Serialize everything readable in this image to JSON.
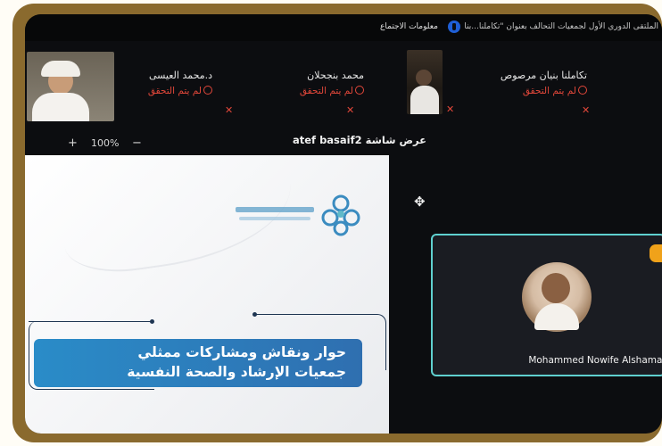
{
  "topbar": {
    "meeting_title": "الملتقى الدوري الأول لجمعيات التحالف بعنوان \"تكاملنا...بنا",
    "meeting_info_label": "معلومات الاجتماع",
    "shield_icon": "shield-icon"
  },
  "participants": [
    {
      "name": "تكاملنا بنيان مرصوص",
      "status": "لم يتم التحقق"
    },
    {
      "name": "محمد بنجحلان",
      "status": "لم يتم التحقق"
    },
    {
      "name": "د.محمد العيسى",
      "status": "لم يتم التحقق"
    }
  ],
  "zoom": {
    "plus": "+",
    "level": "100%",
    "minus": "−"
  },
  "screen_share_label": "عرض شاشة atef basaif2",
  "slide": {
    "banner_line1": "حوار ونقاش ومشاركات ممثلي",
    "banner_line2": "جمعيات الإرشاد والصحة النفسية"
  },
  "active_speaker": {
    "name": "Mohammed Nowife Alshamani"
  },
  "colors": {
    "accent_border": "#5fd0cf",
    "status_red": "#e2473a",
    "banner_blue": "#2a8cc8"
  }
}
